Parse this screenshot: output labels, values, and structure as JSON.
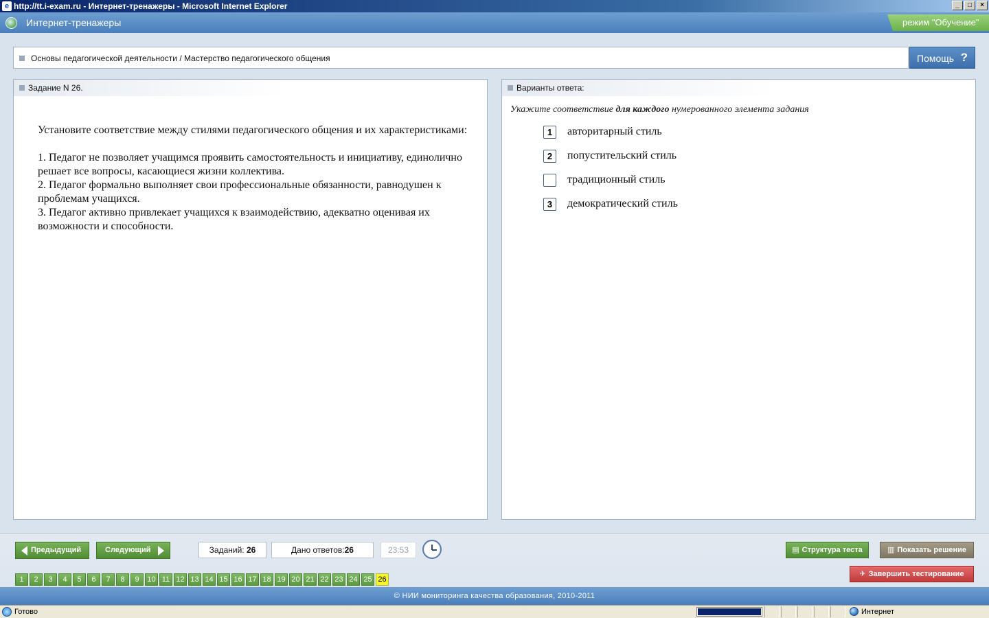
{
  "window": {
    "title": "http://tt.i-exam.ru - Интернет-тренажеры - Microsoft Internet Explorer",
    "btn_min": "_",
    "btn_max": "□",
    "btn_close": "×"
  },
  "header": {
    "app_title": "Интернет-тренажеры",
    "mode": "режим \"Обучение\""
  },
  "breadcrumb": {
    "text": "Основы педагогической деятельности / Мастерство педагогического общения"
  },
  "help": {
    "label": "Помощь",
    "icon": "?"
  },
  "task": {
    "title": "Задание N 26.",
    "lines": [
      "Установите соответствие между стилями педагогического общения и их характеристиками:",
      "1. Педагог не позволяет учащимся проявить самостоятельность и инициативу, единолично решает все вопросы, касающиеся жизни коллектива.",
      "2. Педагог формально выполняет свои профессиональные обязанности, равнодушен к проблемам учащихся.",
      "3. Педагог активно привлекает учащихся к взаимодействию, адекватно оценивая их возможности и способности."
    ]
  },
  "answers": {
    "title": "Варианты ответа:",
    "instruction_pre": "Укажите соответствие ",
    "instruction_bold": "для каждого",
    "instruction_post": " нумерованного элемента задания",
    "items": [
      {
        "value": "1",
        "label": "авторитарный стиль"
      },
      {
        "value": "2",
        "label": "попустительский стиль"
      },
      {
        "value": "",
        "label": "традиционный стиль"
      },
      {
        "value": "3",
        "label": "демократический стиль"
      }
    ]
  },
  "nav": {
    "prev_label": "Предыдущий",
    "next_label": "Следующий",
    "tasks_label": "Заданий:",
    "tasks_value": "26",
    "answered_label": "Дано ответов:",
    "answered_value": "26",
    "timer": "23:53",
    "structure_label": "Структура теста",
    "solution_label": "Показать решение",
    "finish_label": "Завершить тестирование",
    "numbers": [
      "1",
      "2",
      "3",
      "4",
      "5",
      "6",
      "7",
      "8",
      "9",
      "10",
      "11",
      "12",
      "13",
      "14",
      "15",
      "16",
      "17",
      "18",
      "19",
      "20",
      "21",
      "22",
      "23",
      "24",
      "25",
      "26"
    ],
    "current": "26"
  },
  "footer": {
    "text": "© НИИ мониторинга качества образования, 2010-2011"
  },
  "statusbar": {
    "text": "Готово",
    "zone": "Интернет",
    "progress": 1.0
  }
}
